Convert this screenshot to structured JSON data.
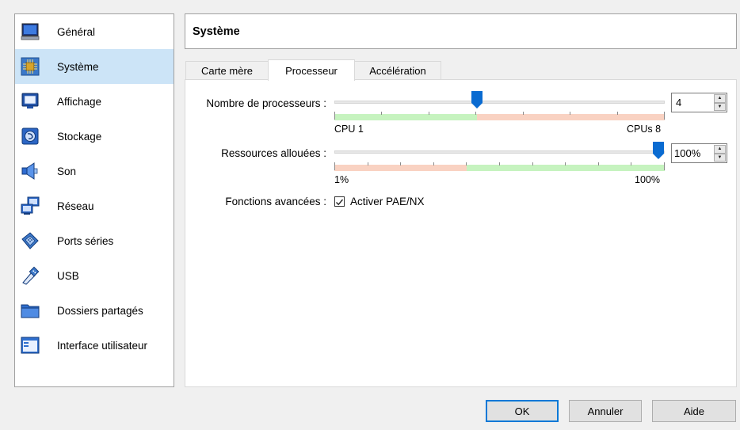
{
  "sidebar": {
    "items": [
      {
        "label": "Général",
        "icon": "monitor-icon"
      },
      {
        "label": "Système",
        "icon": "chip-icon",
        "selected": true
      },
      {
        "label": "Affichage",
        "icon": "display-icon"
      },
      {
        "label": "Stockage",
        "icon": "disk-icon"
      },
      {
        "label": "Son",
        "icon": "speaker-icon"
      },
      {
        "label": "Réseau",
        "icon": "network-icon"
      },
      {
        "label": "Ports séries",
        "icon": "serial-port-icon"
      },
      {
        "label": "USB",
        "icon": "usb-icon"
      },
      {
        "label": "Dossiers partagés",
        "icon": "folder-icon"
      },
      {
        "label": "Interface utilisateur",
        "icon": "window-icon"
      }
    ]
  },
  "header": {
    "title": "Système"
  },
  "tabs": [
    {
      "label": "Carte mère"
    },
    {
      "label": "Processeur",
      "active": true
    },
    {
      "label": "Accélération"
    }
  ],
  "processor": {
    "cpu_count": {
      "label": "Nombre de processeurs :",
      "value": "4",
      "min_label": "CPU 1",
      "max_label": "CPUs 8",
      "min": 1,
      "max": 8,
      "current": 4
    },
    "execution_cap": {
      "label": "Ressources allouées :",
      "value": "100%",
      "min_label": "1%",
      "max_label": "100%",
      "min": 1,
      "max": 100,
      "current": 100
    },
    "extended_features": {
      "label": "Fonctions avancées :",
      "checkbox_label": "Activer PAE/NX",
      "checked": true
    }
  },
  "buttons": {
    "ok": "OK",
    "cancel": "Annuler",
    "help": "Aide"
  },
  "colors": {
    "selected_bg": "#cce4f7",
    "thumb": "#0a6bd1",
    "zone_green": "#c6f3bf",
    "zone_red": "#f9d2c2",
    "accent": "#0078d7"
  }
}
